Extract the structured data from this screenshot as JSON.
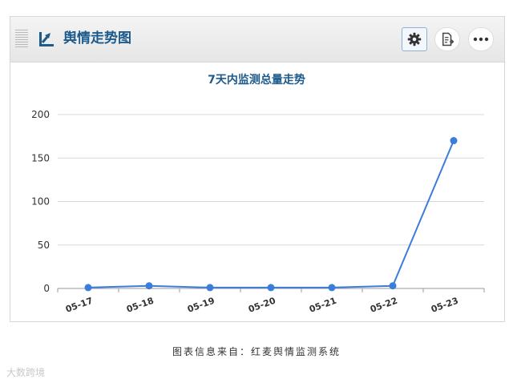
{
  "header": {
    "title": "舆情走势图"
  },
  "chart_data": {
    "type": "line",
    "title": "7天内监测总量走势",
    "categories": [
      "05-17",
      "05-18",
      "05-19",
      "05-20",
      "05-21",
      "05-22",
      "05-23"
    ],
    "series": [
      {
        "values": [
          1,
          3,
          1,
          1,
          1,
          3,
          170
        ]
      }
    ],
    "ylim": [
      0,
      200
    ],
    "yticks": [
      0,
      50,
      100,
      150,
      200
    ],
    "grid": true,
    "legend": "none",
    "line_color": "#3b7dd8"
  },
  "footer": {
    "source_note": "图表信息来自：红麦舆情监测系统",
    "watermark": "大数跨境"
  },
  "colors": {
    "title": "#1d5a8c",
    "line": "#3b7dd8",
    "grid": "#d8d8d8"
  },
  "icons": {
    "trend": "trend-chart-icon",
    "settings": "gear-icon",
    "export": "export-document-icon",
    "more": "more-dots-icon"
  }
}
